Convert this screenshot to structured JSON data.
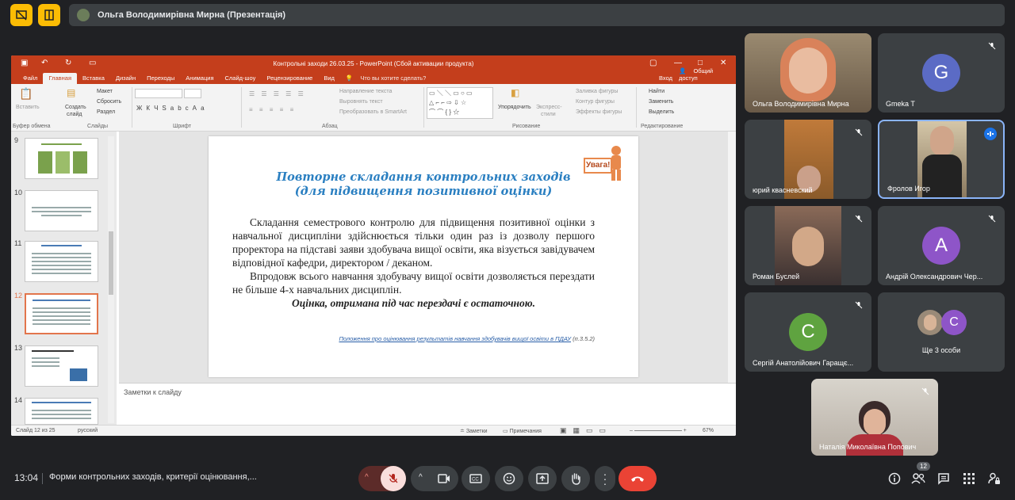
{
  "presenter": {
    "label": "Ольга Володимирівна Мирна (Презентація)"
  },
  "ppt": {
    "window_title": "Контрольні заходи 26.03.25 - PowerPoint (Сбой активации продукта)",
    "tabs": [
      "Файл",
      "Главная",
      "Вставка",
      "Дизайн",
      "Переходы",
      "Анимация",
      "Слайд-шоу",
      "Рецензирование",
      "Вид"
    ],
    "tell_me": "Что вы хотите сделать?",
    "signin": "Вход",
    "share": "Общий доступ",
    "ribbon": {
      "paste": "Вставить",
      "create": "Создать",
      "slide": "слайд",
      "layout": "Макет",
      "reset": "Сбросить",
      "section": "Раздел",
      "text_dir": "Направление текста",
      "align_text": "Выровнять текст",
      "smartart": "Преобразовать в SmartArt",
      "arrange": "Упорядочить",
      "quick_styles": "Экспресс-",
      "styles": "стили",
      "fill": "Заливка фигуры",
      "outline": "Контур фигуры",
      "effects": "Эффекты фигуры",
      "find": "Найти",
      "replace": "Заменить",
      "select": "Выделить",
      "group_clipboard": "Буфер обмена",
      "group_slides": "Слайды",
      "group_font": "Шрифт",
      "group_paragraph": "Абзац",
      "group_drawing": "Рисование",
      "group_editing": "Редактирование",
      "font_bold": "Ж",
      "font_italic": "К",
      "font_underline": "Ч",
      "font_strike": "S",
      "font_abc": "abc",
      "font_aa": "Аа"
    },
    "thumb_numbers": [
      "9",
      "10",
      "11",
      "12",
      "13",
      "14"
    ],
    "slide": {
      "title_line1": "Повторне складання контрольних заходів",
      "title_line2": "(для підвищення позитивної оцінки)",
      "para1": "Складання семестрового контролю для підвищення позитивної оцінки з навчальної дисципліни здійснюється тільки один раз із дозволу першого проректора на підставі заяви здобувача вищої освіти, яка візується завідувачем відповідної кафедри, директором / деканом.",
      "para2": "Впродовж всього навчання здобувачу вищої освіти дозволяється перездати не більше 4-х навчальних дисциплін.",
      "bold": "Оцінка, отримана під час перездачі є остаточною.",
      "link": "Положення про оцінювання результатів навчання здобувачів вищої освіти в ПДАУ",
      "link_ref": "(п.3.5.2)",
      "badge": "Увага!"
    },
    "notes_placeholder": "Заметки к слайду",
    "status": {
      "slide_info": "Слайд 12 из 25",
      "language": "русский",
      "notes": "Заметки",
      "comments": "Примечания",
      "zoom": "67%"
    }
  },
  "participants": [
    {
      "name": "Ольга Володимирівна Мирна"
    },
    {
      "name": "Gmeka T",
      "initial": "G",
      "color": "#5b6bc5"
    },
    {
      "name": "юрий квасневский"
    },
    {
      "name": "Фролов Игор"
    },
    {
      "name": "Роман Буслей"
    },
    {
      "name": "Андрій Олександрович Чер...",
      "initial": "A",
      "color": "#8e55c8"
    },
    {
      "name": "Сергій Анатолійович Гаращє...",
      "initial": "C",
      "color": "#5fa340"
    },
    {
      "name": "Ще 3 особи",
      "initial": "C",
      "color": "#8e55c8"
    },
    {
      "name": "Наталія Миколаївна Попович"
    }
  ],
  "bottom": {
    "time": "13:04",
    "meeting_title": "Форми контрольних заходів, критерії оцінювання,...",
    "people_count": "12"
  },
  "colors": {
    "ppt_accent": "#c43e1c",
    "hangup": "#ea4335",
    "speaking": "#8ab4f8"
  }
}
